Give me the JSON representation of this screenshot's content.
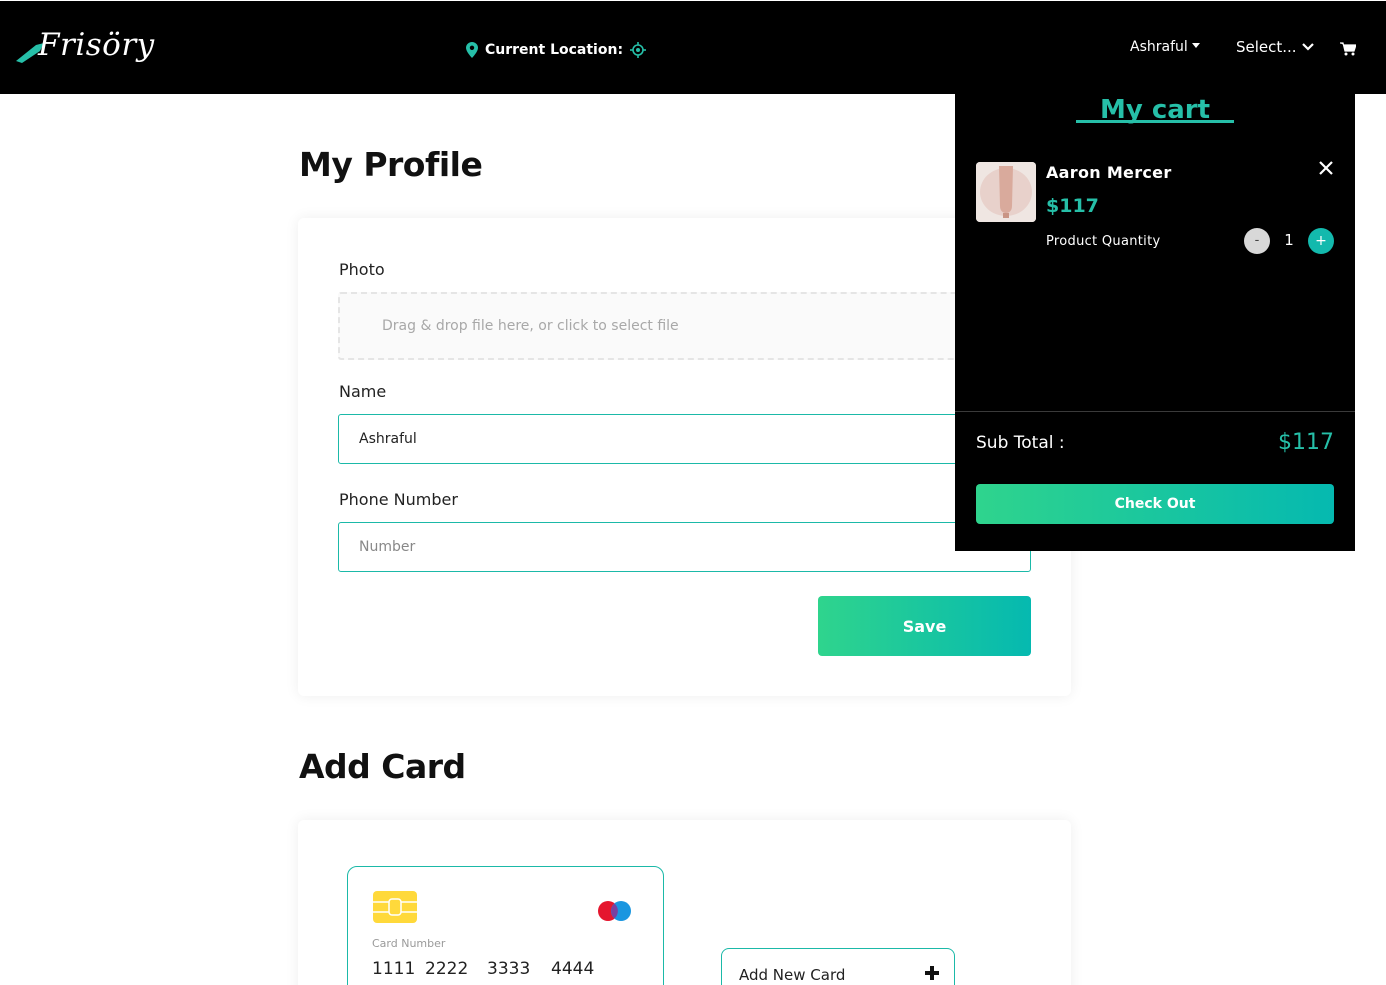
{
  "header": {
    "logo_text": "Frisöry",
    "location_label": "Current Location:",
    "user_name": "Ashraful",
    "select_label": "Select...",
    "accent_color": "#26bfa8"
  },
  "profile": {
    "title": "My Profile",
    "photo_label": "Photo",
    "dropzone_text": "Drag & drop file here, or click to select file",
    "name_label": "Name",
    "name_value": "Ashraful",
    "phone_label": "Phone Number",
    "phone_placeholder": "Number",
    "save_label": "Save"
  },
  "cards": {
    "title": "Add Card",
    "card_number_label": "Card Number",
    "card_number_groups": [
      "1111",
      "2222",
      "3333",
      "4444"
    ],
    "add_new_label": "Add New Card"
  },
  "cart": {
    "title": "My cart",
    "items": [
      {
        "name": "Aaron Mercer",
        "price": "$117",
        "quantity_label": "Product Quantity",
        "quantity": "1"
      }
    ],
    "minus_label": "-",
    "plus_label": "+",
    "subtotal_label": "Sub Total :",
    "subtotal_value": "$117",
    "checkout_label": "Check Out"
  },
  "icons": [
    "location-pin-icon",
    "crosshair-icon",
    "chevron-down-icon",
    "cart-icon",
    "close-icon",
    "plus-icon",
    "chip-icon",
    "card-brand-icon"
  ]
}
